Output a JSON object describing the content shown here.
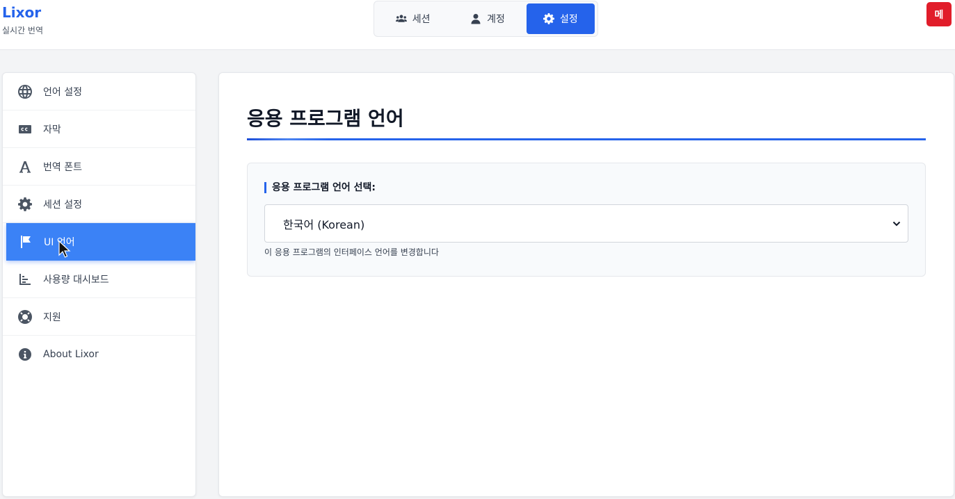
{
  "header": {
    "brand_title": "Lixor",
    "brand_subtitle": "실시간 번역",
    "tabs": [
      {
        "label": "세션",
        "icon": "users-icon"
      },
      {
        "label": "계정",
        "icon": "user-icon"
      },
      {
        "label": "설정",
        "icon": "gear-icon",
        "active": true
      }
    ],
    "menu_button": "메"
  },
  "sidebar": {
    "items": [
      {
        "label": "언어 설정",
        "icon": "globe-icon"
      },
      {
        "label": "자막",
        "icon": "closed-captions-icon"
      },
      {
        "label": "번역 폰트",
        "icon": "font-icon"
      },
      {
        "label": "세션 설정",
        "icon": "gear-icon"
      },
      {
        "label": "UI 언어",
        "icon": "flag-icon",
        "active": true
      },
      {
        "label": "사용량 대시보드",
        "icon": "chart-icon"
      },
      {
        "label": "지원",
        "icon": "lifebuoy-icon"
      },
      {
        "label": "About Lixor",
        "icon": "info-icon"
      }
    ]
  },
  "main": {
    "title": "응용 프로그램 언어",
    "card": {
      "label": "응용 프로그램 언어 선택:",
      "selected_value": "한국어 (Korean)",
      "helper": "이 응용 프로그램의 인터페이스 언어를 변경합니다"
    }
  },
  "colors": {
    "accent": "#2563eb",
    "active_item": "#3b82f6",
    "menu_button": "#e11d2a"
  }
}
